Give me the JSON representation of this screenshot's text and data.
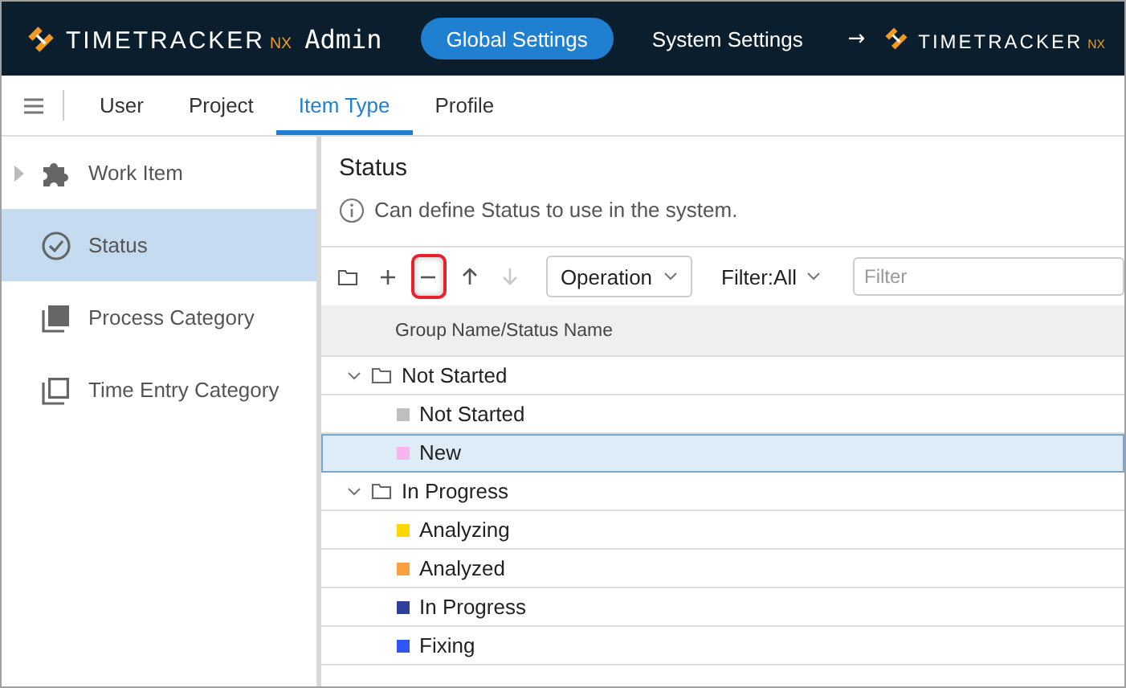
{
  "header": {
    "logo": {
      "name": "TIMETRACKER",
      "suffix": "NX"
    },
    "title": "Admin",
    "tabs": [
      {
        "label": "Global Settings",
        "selected": true
      },
      {
        "label": "System Settings",
        "selected": false
      }
    ],
    "link": {
      "arrow": "→",
      "logo": {
        "name": "TIMETRACKER",
        "suffix": "NX"
      }
    }
  },
  "nav": {
    "tabs": [
      {
        "label": "User",
        "selected": false
      },
      {
        "label": "Project",
        "selected": false
      },
      {
        "label": "Item Type",
        "selected": true
      },
      {
        "label": "Profile",
        "selected": false
      }
    ]
  },
  "sidebar": {
    "items": [
      {
        "label": "Work Item",
        "kind": "puzzle",
        "expandable": true,
        "selected": false
      },
      {
        "label": "Status",
        "kind": "check",
        "expandable": false,
        "selected": true
      },
      {
        "label": "Process Category",
        "kind": "filled",
        "expandable": false,
        "selected": false
      },
      {
        "label": "Time Entry Category",
        "kind": "outline",
        "expandable": false,
        "selected": false
      }
    ]
  },
  "content": {
    "title": "Status",
    "info": "Can define Status to use in the system.",
    "toolbar": {
      "buttons": [
        {
          "kind": "folder",
          "disabled": false,
          "highlighted": false
        },
        {
          "kind": "add",
          "disabled": false,
          "highlighted": false
        },
        {
          "kind": "remove",
          "disabled": false,
          "highlighted": true
        },
        {
          "kind": "up",
          "disabled": false,
          "highlighted": false
        },
        {
          "kind": "down",
          "disabled": true,
          "highlighted": false
        }
      ],
      "operation": "Operation",
      "filter": "Filter:All",
      "filter_placeholder": "Filter"
    },
    "table": {
      "columns": [
        "Group Name/Status Name"
      ],
      "rows": [
        {
          "label": "Not Started",
          "expanded": true,
          "selected": false,
          "children": [
            {
              "label": "Not Started",
              "color": "#bfbfbf",
              "selected": false
            },
            {
              "label": "New",
              "color": "#f8b4ee",
              "selected": true
            }
          ]
        },
        {
          "label": "In Progress",
          "expanded": true,
          "selected": false,
          "children": [
            {
              "label": "Analyzing",
              "color": "#ffd800",
              "selected": false
            },
            {
              "label": "Analyzed",
              "color": "#ffa040",
              "selected": false
            },
            {
              "label": "In Progress",
              "color": "#2e3e9c",
              "selected": false
            },
            {
              "label": "Fixing",
              "color": "#2f55f5",
              "selected": false
            }
          ]
        }
      ]
    }
  }
}
